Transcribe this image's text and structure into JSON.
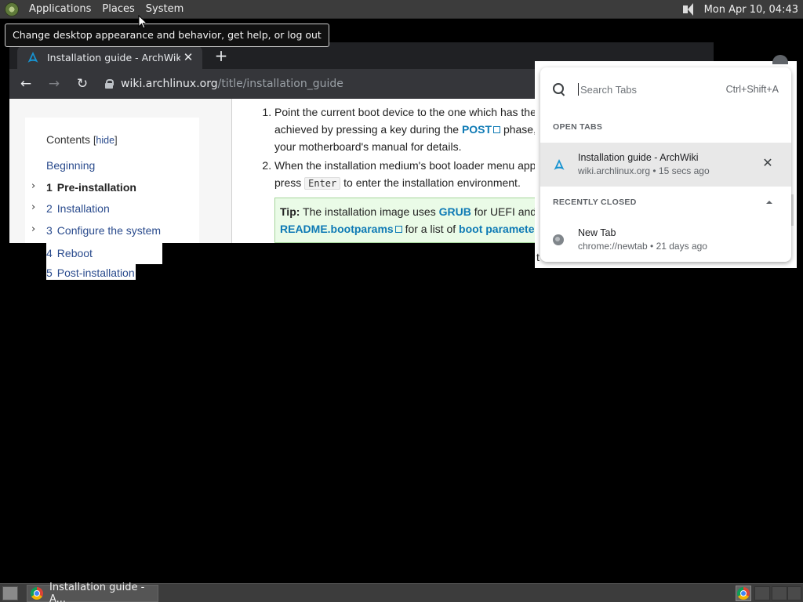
{
  "top_panel": {
    "menus": [
      "Applications",
      "Places",
      "System"
    ],
    "clock": "Mon Apr 10, 04:43"
  },
  "tooltip": "Change desktop appearance and behavior, get help, or log out",
  "ghost_tab_text": "stal",
  "browser": {
    "tab_title": "Installation guide - ArchWiki",
    "tab_close": "✕",
    "new_tab": "+",
    "nav": {
      "back": "←",
      "forward": "→",
      "reload": "↻"
    },
    "url_host": "wiki.archlinux.org",
    "url_path": "/title/installation_guide"
  },
  "toc": {
    "heading": "Contents",
    "hide_open": "[",
    "hide_label": "hide",
    "hide_close": "]",
    "items": [
      {
        "num": "",
        "label": "Beginning"
      },
      {
        "num": "1",
        "label": "Pre-installation"
      },
      {
        "num": "2",
        "label": "Installation"
      },
      {
        "num": "3",
        "label": "Configure the system"
      },
      {
        "num": "4",
        "label": "Reboot"
      },
      {
        "num": "5",
        "label": "Post-installation"
      }
    ]
  },
  "content": {
    "li1_a": "Point the current boot device to the one which has the A",
    "li1_b": "achieved by pressing a key during the ",
    "li1_link": "POST",
    "li1_c": " phase, ",
    "li1_d": "your motherboard's manual for details.",
    "li2_a": "When the installation medium's boot loader menu appe",
    "li2_b": "press ",
    "li2_kbd": "Enter",
    "li2_c": " to enter the installation environment.",
    "tip_label": "Tip:",
    "tip_a": " The installation image uses ",
    "tip_link1": "GRUB",
    "tip_b": " for UEFI and s",
    "tip_link2": "README.bootparams",
    "tip_c": " for a list of ",
    "tip_link3": "boot parameter",
    "cut_t": "t"
  },
  "tab_search": {
    "placeholder": "Search Tabs",
    "shortcut": "Ctrl+Shift+A",
    "open_tabs_label": "OPEN TABS",
    "open_tabs": [
      {
        "title": "Installation guide - ArchWiki",
        "subtitle": "wiki.archlinux.org • 15 secs ago",
        "close": "✕"
      }
    ],
    "recently_closed_label": "RECENTLY CLOSED",
    "recently_closed": [
      {
        "title": "New Tab",
        "subtitle": "chrome://newtab • 21 days ago"
      }
    ]
  },
  "bottom_panel": {
    "task_title": "Installation guide - A..."
  },
  "colors": {
    "link": "#0e7ab5",
    "toc_link": "#2a4b8d",
    "panel": "#3c3c3c",
    "chrome_dark": "#35363a"
  }
}
